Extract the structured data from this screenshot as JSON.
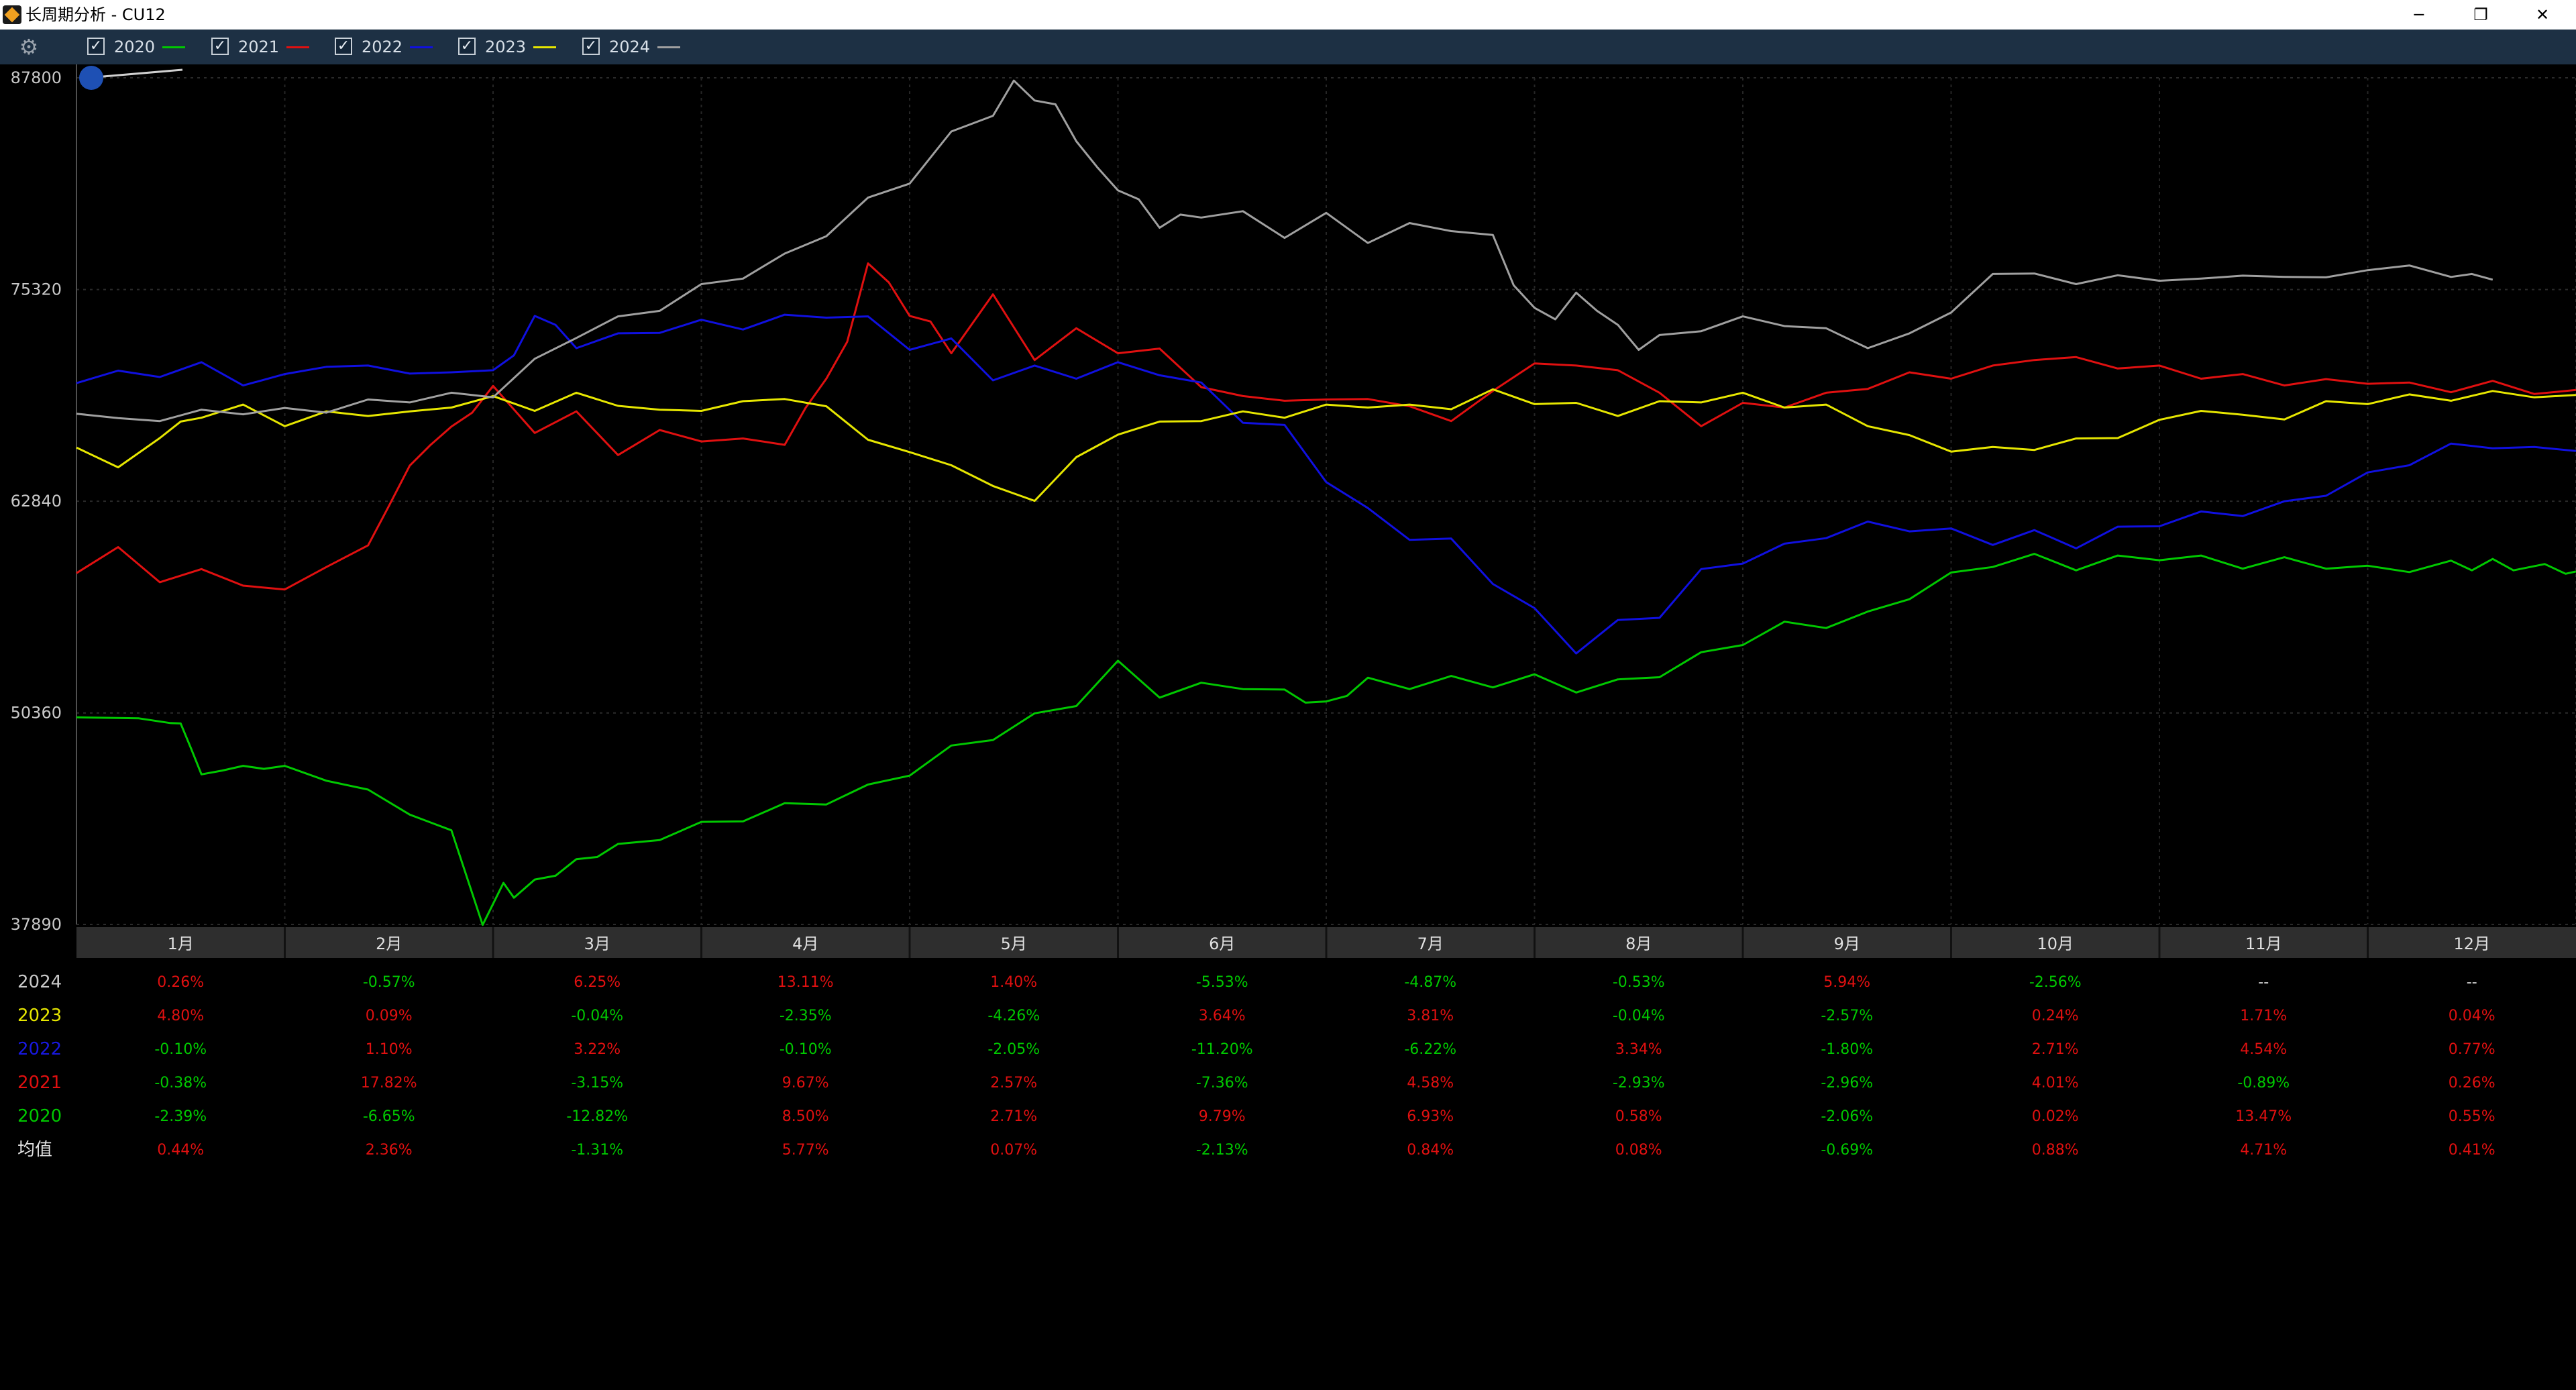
{
  "window": {
    "title": "长周期分析 - CU12",
    "minimize_glyph": "─",
    "restore_glyph": "❐",
    "close_glyph": "✕"
  },
  "legend": {
    "settings_icon": "gear-icon",
    "items": [
      {
        "label": "2020",
        "color": "#00c800",
        "checked": true
      },
      {
        "label": "2021",
        "color": "#e01010",
        "checked": true
      },
      {
        "label": "2022",
        "color": "#1010e0",
        "checked": true
      },
      {
        "label": "2023",
        "color": "#e6e600",
        "checked": true
      },
      {
        "label": "2024",
        "color": "#a0a0a0",
        "checked": true
      }
    ]
  },
  "chart_data": {
    "type": "line",
    "yticks": [
      87800,
      75320,
      62840,
      50360,
      37890
    ],
    "ylim": [
      37890,
      87800
    ],
    "months": [
      "1月",
      "2月",
      "3月",
      "4月",
      "5月",
      "6月",
      "7月",
      "8月",
      "9月",
      "10月",
      "11月",
      "12月"
    ],
    "grid": true,
    "x_unit": "month",
    "series": [
      {
        "name": "2020",
        "color": "#00c800",
        "x": [
          0,
          0.3,
          0.45,
          0.5,
          0.55,
          0.6,
          0.7,
          0.8,
          0.9,
          1.0,
          1.2,
          1.4,
          1.6,
          1.8,
          1.95,
          2.05,
          2.1,
          2.2,
          2.3,
          2.4,
          2.5,
          2.6,
          2.8,
          3.0,
          3.2,
          3.4,
          3.6,
          3.8,
          4.0,
          4.2,
          4.4,
          4.6,
          4.8,
          5.0,
          5.2,
          5.4,
          5.6,
          5.8,
          5.9,
          6.0,
          6.1,
          6.2,
          6.4,
          6.6,
          6.8,
          7.0,
          7.2,
          7.4,
          7.6,
          7.8,
          8.0,
          8.2,
          8.4,
          8.6,
          8.8,
          9.0,
          9.2,
          9.4,
          9.6,
          9.8,
          10.0,
          10.2,
          10.4,
          10.6,
          10.8,
          11.0,
          11.2,
          11.4,
          11.5,
          11.6,
          11.7,
          11.85,
          11.95,
          12.0
        ],
        "y": [
          50100,
          49800,
          50000,
          49500,
          48500,
          46500,
          47200,
          47000,
          47300,
          47000,
          46600,
          45600,
          44600,
          43200,
          38100,
          40100,
          39700,
          40300,
          41000,
          41500,
          42100,
          42400,
          43100,
          43700,
          44200,
          44800,
          45200,
          45900,
          46900,
          48200,
          49000,
          50100,
          51000,
          53200,
          51500,
          51900,
          52000,
          51500,
          51200,
          50800,
          51600,
          52200,
          52000,
          52300,
          52100,
          52400,
          51800,
          52100,
          52700,
          53700,
          54600,
          55500,
          55600,
          56100,
          57300,
          58400,
          59200,
          59500,
          59000,
          59400,
          59600,
          59400,
          59100,
          59300,
          59100,
          58800,
          58900,
          59100,
          59000,
          59200,
          59000,
          58900,
          58800,
          58700
        ]
      },
      {
        "name": "2021",
        "color": "#e01010",
        "x": [
          0,
          0.2,
          0.4,
          0.6,
          0.8,
          1.0,
          1.2,
          1.4,
          1.5,
          1.6,
          1.7,
          1.8,
          1.9,
          2.0,
          2.2,
          2.4,
          2.6,
          2.8,
          3.0,
          3.2,
          3.4,
          3.5,
          3.6,
          3.7,
          3.8,
          3.9,
          4.0,
          4.1,
          4.2,
          4.4,
          4.6,
          4.8,
          5.0,
          5.2,
          5.4,
          5.6,
          5.8,
          6.0,
          6.2,
          6.4,
          6.6,
          6.8,
          7.0,
          7.2,
          7.4,
          7.6,
          7.8,
          8.0,
          8.2,
          8.4,
          8.6,
          8.8,
          9.0,
          9.2,
          9.4,
          9.6,
          9.8,
          10.0,
          10.2,
          10.4,
          10.6,
          10.8,
          11.0,
          11.2,
          11.4,
          11.6,
          11.8,
          12.0
        ],
        "y": [
          58600,
          59900,
          58300,
          58600,
          58100,
          57400,
          59200,
          60000,
          62800,
          64700,
          66400,
          67000,
          68300,
          69400,
          67100,
          67900,
          65800,
          66800,
          66600,
          66300,
          66400,
          68100,
          70300,
          72000,
          77100,
          75500,
          74000,
          73200,
          71800,
          74800,
          71400,
          72800,
          71800,
          71600,
          69800,
          68800,
          69000,
          68600,
          69100,
          68200,
          67800,
          69100,
          71200,
          70600,
          70800,
          69000,
          67500,
          68400,
          68600,
          69000,
          69700,
          70200,
          70300,
          70600,
          71400,
          71100,
          70900,
          70600,
          70300,
          70100,
          69900,
          69800,
          70000,
          69600,
          69500,
          69700,
          69400,
          69400
        ]
      },
      {
        "name": "2022",
        "color": "#1010e0",
        "x": [
          0,
          0.2,
          0.4,
          0.6,
          0.8,
          1.0,
          1.2,
          1.4,
          1.6,
          1.8,
          2.0,
          2.1,
          2.2,
          2.3,
          2.4,
          2.6,
          2.8,
          3.0,
          3.2,
          3.4,
          3.6,
          3.8,
          4.0,
          4.2,
          4.4,
          4.6,
          4.8,
          5.0,
          5.2,
          5.4,
          5.6,
          5.8,
          6.0,
          6.2,
          6.4,
          6.6,
          6.8,
          7.0,
          7.2,
          7.4,
          7.6,
          7.8,
          8.0,
          8.2,
          8.4,
          8.6,
          8.8,
          9.0,
          9.2,
          9.4,
          9.6,
          9.8,
          10.0,
          10.2,
          10.4,
          10.6,
          10.8,
          11.0,
          11.2,
          11.4,
          11.6,
          11.8,
          12.0
        ],
        "y": [
          69800,
          70300,
          70400,
          70800,
          69900,
          70100,
          71000,
          70600,
          70600,
          70200,
          70800,
          71200,
          74000,
          73000,
          72100,
          72500,
          73000,
          73300,
          73200,
          73600,
          73900,
          73500,
          72000,
          72200,
          70200,
          70600,
          70300,
          70800,
          70500,
          69600,
          67700,
          67100,
          64200,
          62200,
          60800,
          60400,
          58200,
          56300,
          54100,
          55600,
          56200,
          58600,
          59400,
          60100,
          60900,
          61400,
          61300,
          61000,
          60500,
          60900,
          60300,
          61100,
          61600,
          62000,
          62200,
          62600,
          63400,
          64300,
          65200,
          66000,
          66200,
          65800,
          65800
        ]
      },
      {
        "name": "2023",
        "color": "#e6e600",
        "x": [
          0,
          0.2,
          0.4,
          0.5,
          0.6,
          0.8,
          1.0,
          1.2,
          1.4,
          1.6,
          1.8,
          2.0,
          2.2,
          2.4,
          2.6,
          2.8,
          3.0,
          3.2,
          3.4,
          3.6,
          3.8,
          4.0,
          4.2,
          4.4,
          4.6,
          4.8,
          5.0,
          5.2,
          5.4,
          5.6,
          5.8,
          6.0,
          6.2,
          6.4,
          6.6,
          6.8,
          7.0,
          7.2,
          7.4,
          7.6,
          7.8,
          8.0,
          8.2,
          8.4,
          8.6,
          8.8,
          9.0,
          9.2,
          9.4,
          9.6,
          9.8,
          10.0,
          10.2,
          10.4,
          10.6,
          10.8,
          11.0,
          11.2,
          11.4,
          11.6,
          11.8,
          12.0
        ],
        "y": [
          66000,
          64600,
          66800,
          67300,
          68000,
          68300,
          67500,
          67900,
          68100,
          67900,
          68600,
          68800,
          68400,
          69000,
          68700,
          68000,
          68400,
          68500,
          69100,
          68200,
          66700,
          65500,
          65200,
          63500,
          63100,
          65200,
          67000,
          67300,
          67800,
          67900,
          68000,
          68300,
          68600,
          68300,
          68500,
          69200,
          68800,
          68400,
          68100,
          68500,
          68900,
          69000,
          68600,
          68300,
          67500,
          66500,
          66000,
          65800,
          66100,
          66300,
          66800,
          67400,
          68400,
          67700,
          67900,
          68500,
          68800,
          68900,
          69000,
          69100,
          69200,
          69100
        ]
      },
      {
        "name": "2024",
        "color": "#a0a0a0",
        "x": [
          0,
          0.2,
          0.4,
          0.6,
          0.8,
          1.0,
          1.2,
          1.4,
          1.6,
          1.8,
          2.0,
          2.2,
          2.4,
          2.6,
          2.8,
          3.0,
          3.2,
          3.4,
          3.6,
          3.8,
          4.0,
          4.2,
          4.4,
          4.5,
          4.6,
          4.7,
          4.8,
          4.9,
          5.0,
          5.1,
          5.2,
          5.3,
          5.4,
          5.6,
          5.8,
          6.0,
          6.2,
          6.4,
          6.6,
          6.8,
          6.9,
          7.0,
          7.1,
          7.2,
          7.3,
          7.4,
          7.5,
          7.6,
          7.8,
          8.0,
          8.2,
          8.4,
          8.6,
          8.8,
          9.0,
          9.2,
          9.4,
          9.6,
          9.8,
          10.0,
          10.2,
          10.4,
          10.6,
          10.8,
          11.0,
          11.2,
          11.4,
          11.5,
          11.6
        ],
        "y": [
          68000,
          67500,
          67800,
          68000,
          68200,
          68100,
          68300,
          68600,
          68900,
          69000,
          69200,
          71000,
          72700,
          73500,
          74300,
          75400,
          76200,
          77200,
          78700,
          80500,
          81800,
          84400,
          85800,
          87400,
          86700,
          86000,
          84300,
          82300,
          81400,
          80400,
          79200,
          79500,
          79800,
          79700,
          78600,
          79600,
          78300,
          79000,
          79000,
          78300,
          75800,
          74000,
          73800,
          74900,
          74300,
          73000,
          72000,
          72400,
          73100,
          73500,
          73400,
          72800,
          72100,
          72500,
          74200,
          76000,
          76500,
          75400,
          76400,
          75600,
          76200,
          75900,
          76300,
          75800,
          76700,
          76500,
          76300,
          76000,
          75900
        ]
      }
    ]
  },
  "table": {
    "rows": [
      {
        "label": "2024",
        "label_color": "#c8c8c8",
        "cells": [
          [
            "0.26%",
            "#e01010"
          ],
          [
            "-0.57%",
            "#00c800"
          ],
          [
            "6.25%",
            "#e01010"
          ],
          [
            "13.11%",
            "#e01010"
          ],
          [
            "1.40%",
            "#e01010"
          ],
          [
            "-5.53%",
            "#00c800"
          ],
          [
            "-4.87%",
            "#00c800"
          ],
          [
            "-0.53%",
            "#00c800"
          ],
          [
            "5.94%",
            "#e01010"
          ],
          [
            "-2.56%",
            "#00c800"
          ],
          [
            "--",
            "#e0e0e0"
          ],
          [
            "--",
            "#e0e0e0"
          ]
        ]
      },
      {
        "label": "2023",
        "label_color": "#e6e600",
        "cells": [
          [
            "4.80%",
            "#e01010"
          ],
          [
            "0.09%",
            "#e01010"
          ],
          [
            "-0.04%",
            "#00c800"
          ],
          [
            "-2.35%",
            "#00c800"
          ],
          [
            "-4.26%",
            "#00c800"
          ],
          [
            "3.64%",
            "#e01010"
          ],
          [
            "3.81%",
            "#e01010"
          ],
          [
            "-0.04%",
            "#00c800"
          ],
          [
            "-2.57%",
            "#00c800"
          ],
          [
            "0.24%",
            "#e01010"
          ],
          [
            "1.71%",
            "#e01010"
          ],
          [
            "0.04%",
            "#e01010"
          ]
        ]
      },
      {
        "label": "2022",
        "label_color": "#1818e0",
        "cells": [
          [
            "-0.10%",
            "#00c800"
          ],
          [
            "1.10%",
            "#e01010"
          ],
          [
            "3.22%",
            "#e01010"
          ],
          [
            "-0.10%",
            "#00c800"
          ],
          [
            "-2.05%",
            "#00c800"
          ],
          [
            "-11.20%",
            "#00c800"
          ],
          [
            "-6.22%",
            "#00c800"
          ],
          [
            "3.34%",
            "#e01010"
          ],
          [
            "-1.80%",
            "#00c800"
          ],
          [
            "2.71%",
            "#e01010"
          ],
          [
            "4.54%",
            "#e01010"
          ],
          [
            "0.77%",
            "#e01010"
          ]
        ]
      },
      {
        "label": "2021",
        "label_color": "#e01010",
        "cells": [
          [
            "-0.38%",
            "#00c800"
          ],
          [
            "17.82%",
            "#e01010"
          ],
          [
            "-3.15%",
            "#00c800"
          ],
          [
            "9.67%",
            "#e01010"
          ],
          [
            "2.57%",
            "#e01010"
          ],
          [
            "-7.36%",
            "#00c800"
          ],
          [
            "4.58%",
            "#e01010"
          ],
          [
            "-2.93%",
            "#00c800"
          ],
          [
            "-2.96%",
            "#00c800"
          ],
          [
            "4.01%",
            "#e01010"
          ],
          [
            "-0.89%",
            "#00c800"
          ],
          [
            "0.26%",
            "#e01010"
          ]
        ]
      },
      {
        "label": "2020",
        "label_color": "#00c800",
        "cells": [
          [
            "-2.39%",
            "#00c800"
          ],
          [
            "-6.65%",
            "#00c800"
          ],
          [
            "-12.82%",
            "#00c800"
          ],
          [
            "8.50%",
            "#e01010"
          ],
          [
            "2.71%",
            "#e01010"
          ],
          [
            "9.79%",
            "#e01010"
          ],
          [
            "6.93%",
            "#e01010"
          ],
          [
            "0.58%",
            "#e01010"
          ],
          [
            "-2.06%",
            "#00c800"
          ],
          [
            "0.02%",
            "#e01010"
          ],
          [
            "13.47%",
            "#e01010"
          ],
          [
            "0.55%",
            "#e01010"
          ]
        ]
      },
      {
        "label": "均值",
        "label_color": "#e0e0e0",
        "cells": [
          [
            "0.44%",
            "#e01010"
          ],
          [
            "2.36%",
            "#e01010"
          ],
          [
            "-1.31%",
            "#00c800"
          ],
          [
            "5.77%",
            "#e01010"
          ],
          [
            "0.07%",
            "#e01010"
          ],
          [
            "-2.13%",
            "#00c800"
          ],
          [
            "0.84%",
            "#e01010"
          ],
          [
            "0.08%",
            "#e01010"
          ],
          [
            "-0.69%",
            "#00c800"
          ],
          [
            "0.88%",
            "#e01010"
          ],
          [
            "4.71%",
            "#e01010"
          ],
          [
            "0.41%",
            "#e01010"
          ]
        ]
      }
    ]
  }
}
